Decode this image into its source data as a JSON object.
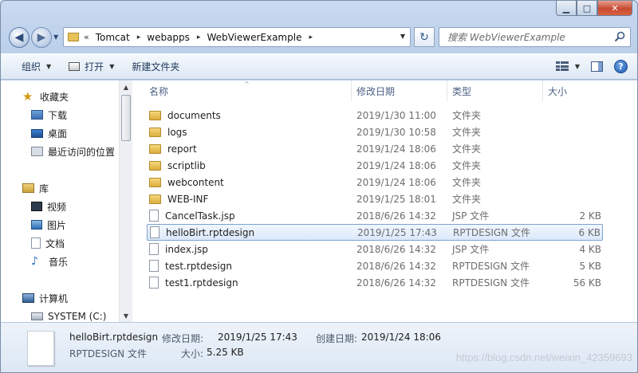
{
  "window": {
    "minimize": "▁",
    "maximize": "□",
    "close": "✕"
  },
  "nav": {
    "back": "◀",
    "forward": "▶",
    "dropdown": "▼"
  },
  "address": {
    "overflow": "«",
    "crumbs": [
      "Tomcat",
      "webapps",
      "WebViewerExample"
    ],
    "separator": "▸",
    "dropdown": "▼",
    "refresh": "↻"
  },
  "search": {
    "placeholder": "搜索 WebViewerExample"
  },
  "toolbar": {
    "organize": "组织",
    "open": "打开",
    "new_folder": "新建文件夹",
    "dd": "▼",
    "help": "?"
  },
  "sidebar": {
    "favorites": "收藏夹",
    "downloads": "下载",
    "desktop": "桌面",
    "recent": "最近访问的位置",
    "libraries": "库",
    "videos": "视频",
    "pictures": "图片",
    "documents": "文档",
    "music": "音乐",
    "computer": "计算机",
    "drive": "SYSTEM (C:)"
  },
  "scroll": {
    "up": "▲",
    "down": "▼"
  },
  "columns": {
    "name": "名称",
    "modified": "修改日期",
    "type": "类型",
    "size": "大小",
    "sort_arrow": "^"
  },
  "files": [
    {
      "name": "documents",
      "date": "2019/1/30 11:00",
      "type": "文件夹",
      "size": "",
      "kind": "folder"
    },
    {
      "name": "logs",
      "date": "2019/1/30 10:58",
      "type": "文件夹",
      "size": "",
      "kind": "folder"
    },
    {
      "name": "report",
      "date": "2019/1/24 18:06",
      "type": "文件夹",
      "size": "",
      "kind": "folder"
    },
    {
      "name": "scriptlib",
      "date": "2019/1/24 18:06",
      "type": "文件夹",
      "size": "",
      "kind": "folder"
    },
    {
      "name": "webcontent",
      "date": "2019/1/24 18:06",
      "type": "文件夹",
      "size": "",
      "kind": "folder"
    },
    {
      "name": "WEB-INF",
      "date": "2019/1/25 18:01",
      "type": "文件夹",
      "size": "",
      "kind": "folder"
    },
    {
      "name": "CancelTask.jsp",
      "date": "2018/6/26 14:32",
      "type": "JSP 文件",
      "size": "2 KB",
      "kind": "file"
    },
    {
      "name": "helloBirt.rptdesign",
      "date": "2019/1/25 17:43",
      "type": "RPTDESIGN 文件",
      "size": "6 KB",
      "kind": "file"
    },
    {
      "name": "index.jsp",
      "date": "2018/6/26 14:32",
      "type": "JSP 文件",
      "size": "4 KB",
      "kind": "file"
    },
    {
      "name": "test.rptdesign",
      "date": "2018/6/26 14:32",
      "type": "RPTDESIGN 文件",
      "size": "5 KB",
      "kind": "file"
    },
    {
      "name": "test1.rptdesign",
      "date": "2018/6/26 14:32",
      "type": "RPTDESIGN 文件",
      "size": "56 KB",
      "kind": "file"
    }
  ],
  "selected_index": 7,
  "details": {
    "name": "helloBirt.rptdesign",
    "type": "RPTDESIGN 文件",
    "modified_label": "修改日期:",
    "modified_value": "2019/1/25 17:43",
    "size_label": "大小:",
    "size_value": "5.25 KB",
    "created_label": "创建日期:",
    "created_value": "2019/1/24 18:06"
  },
  "watermark": "https://blog.csdn.net/weixin_42359693",
  "colors": {
    "accent": "#1f5eb4",
    "selection_border": "#7da2ce",
    "folder": "#dcae3c"
  }
}
